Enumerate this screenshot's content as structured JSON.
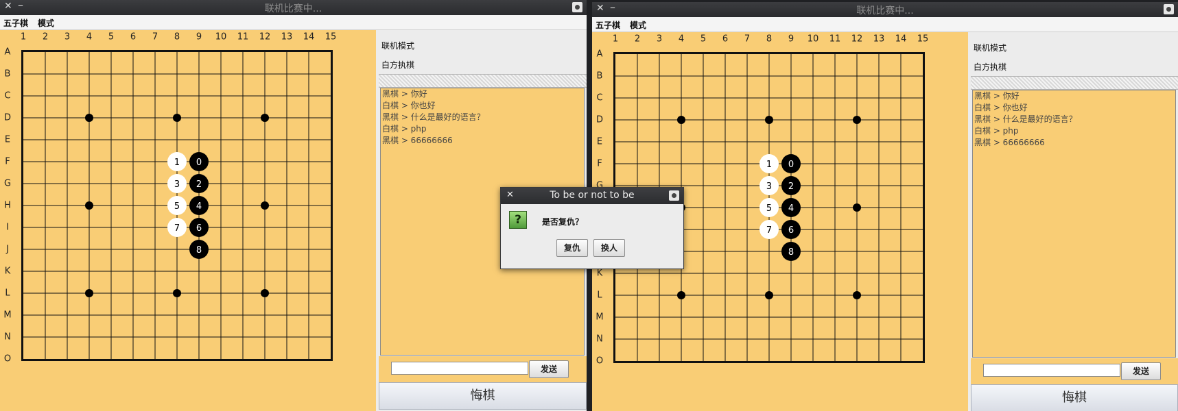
{
  "windows": [
    {
      "title": "联机比赛中...",
      "menu": [
        "五子棋",
        "模式"
      ],
      "info_mode": "联机模式",
      "info_turn": "白方执棋",
      "chat": [
        "黑棋 > 你好",
        "白棋 > 你也好",
        "黑棋 > 什么是最好的语言？",
        "白棋 > php",
        "黑棋 > 66666666"
      ],
      "send_label": "发送",
      "undo_label": "悔棋"
    },
    {
      "title": "联机比赛中...",
      "menu": [
        "五子棋",
        "模式"
      ],
      "info_mode": "联机模式",
      "info_turn": "白方执棋",
      "chat": [
        "黑棋 > 你好",
        "白棋 > 你也好",
        "黑棋 > 什么是最好的语言？",
        "白棋 > php",
        "黑棋 > 66666666"
      ],
      "send_label": "发送",
      "undo_label": "悔棋"
    }
  ],
  "board": {
    "columns": [
      "1",
      "2",
      "3",
      "4",
      "5",
      "6",
      "7",
      "8",
      "9",
      "10",
      "11",
      "12",
      "13",
      "14",
      "15"
    ],
    "rows": [
      "A",
      "B",
      "C",
      "D",
      "E",
      "F",
      "G",
      "H",
      "I",
      "J",
      "K",
      "L",
      "M",
      "N",
      "O"
    ],
    "star_points": [
      [
        4,
        "D"
      ],
      [
        8,
        "D"
      ],
      [
        12,
        "D"
      ],
      [
        4,
        "H"
      ],
      [
        12,
        "H"
      ],
      [
        4,
        "L"
      ],
      [
        8,
        "L"
      ],
      [
        12,
        "L"
      ]
    ],
    "stones": [
      {
        "label": "0",
        "color": "black",
        "col": 9,
        "row": "F"
      },
      {
        "label": "1",
        "color": "white",
        "col": 8,
        "row": "F"
      },
      {
        "label": "2",
        "color": "black",
        "col": 9,
        "row": "G"
      },
      {
        "label": "3",
        "color": "white",
        "col": 8,
        "row": "G"
      },
      {
        "label": "4",
        "color": "black",
        "col": 9,
        "row": "H"
      },
      {
        "label": "5",
        "color": "white",
        "col": 8,
        "row": "H"
      },
      {
        "label": "6",
        "color": "black",
        "col": 9,
        "row": "I"
      },
      {
        "label": "7",
        "color": "white",
        "col": 8,
        "row": "I"
      },
      {
        "label": "8",
        "color": "black",
        "col": 9,
        "row": "J"
      }
    ]
  },
  "dialog": {
    "title": "To be or not to be",
    "message": "是否复仇？",
    "icon": "question-icon",
    "buttons": [
      "复仇",
      "换人"
    ]
  },
  "colors": {
    "board": "#f9cd75",
    "grid_line": "#111111",
    "stone_black": "#000000",
    "stone_white": "#ffffff",
    "titlebar": "#2e2f32"
  }
}
